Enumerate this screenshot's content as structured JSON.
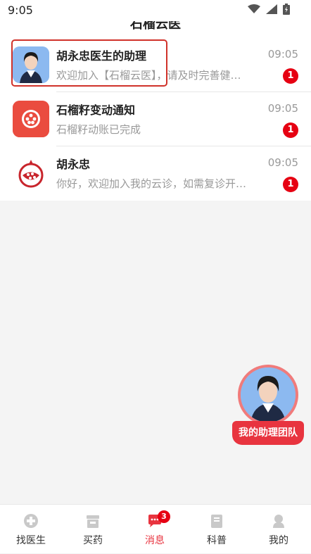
{
  "status_bar": {
    "time": "9:05",
    "icons": [
      "wifi-icon",
      "signal-icon",
      "battery-icon"
    ]
  },
  "header": {
    "title": "石榴云医"
  },
  "messages": [
    {
      "name": "胡永忠医生的助理",
      "preview": "欢迎加入【石榴云医】，请及时完善健…",
      "time": "09:05",
      "unread": "1",
      "avatar": "assistant-photo"
    },
    {
      "name": "石榴籽变动通知",
      "preview": "石榴籽动账已完成",
      "time": "09:05",
      "unread": "1",
      "avatar": "pomegranate-seed-icon"
    },
    {
      "name": "胡永忠",
      "preview": "你好，欢迎加入我的云诊，如需复诊开…",
      "time": "09:05",
      "unread": "1",
      "avatar": "pomegranate-logo"
    }
  ],
  "floating_button": {
    "label": "我的助理团队"
  },
  "tabbar": {
    "items": [
      {
        "label": "找医生",
        "icon": "plus-cross-icon"
      },
      {
        "label": "买药",
        "icon": "medicine-box-icon"
      },
      {
        "label": "消息",
        "icon": "chat-bubble-icon",
        "badge": "3"
      },
      {
        "label": "科普",
        "icon": "book-icon"
      },
      {
        "label": "我的",
        "icon": "user-icon"
      }
    ],
    "active": "消息"
  },
  "colors": {
    "accent": "#e8343f",
    "badge": "#e60012",
    "highlight_border": "#d0322a"
  }
}
